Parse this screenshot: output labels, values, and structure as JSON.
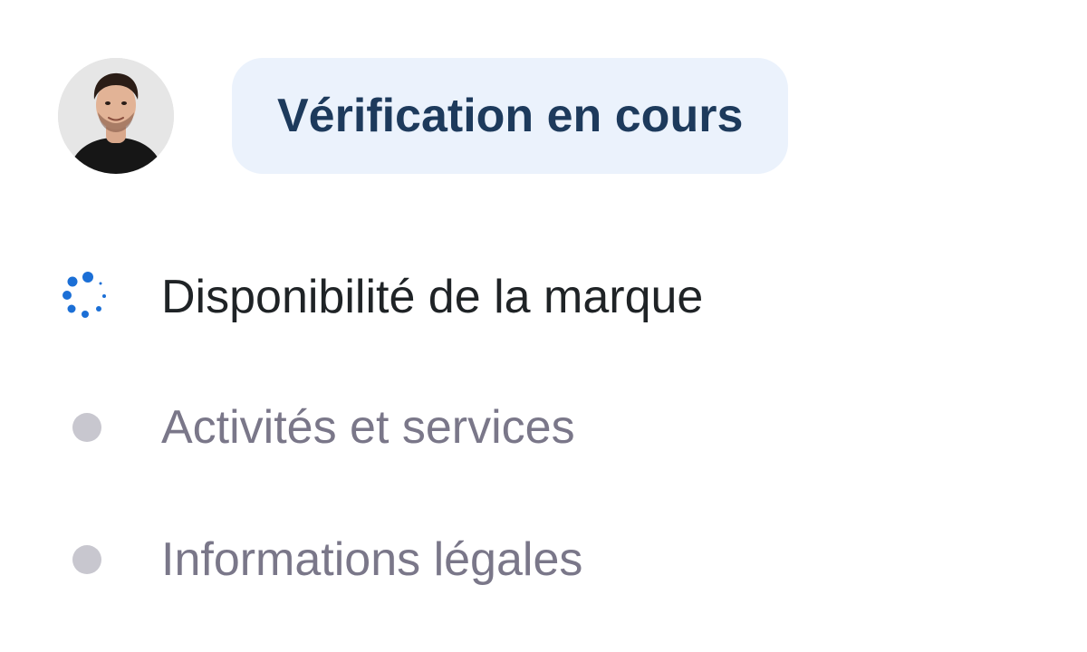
{
  "status": {
    "label": "Vérification en cours"
  },
  "steps": [
    {
      "label": "Disponibilité de la marque",
      "state": "in-progress"
    },
    {
      "label": "Activités et services",
      "state": "pending"
    },
    {
      "label": "Informations légales",
      "state": "pending"
    }
  ],
  "colors": {
    "pill_bg": "#ebf2fc",
    "pill_text": "#1d3a5c",
    "spinner": "#1b6fd6",
    "active_text": "#1f2326",
    "pending_text": "#7a7789",
    "pending_dot": "#c8c7cf"
  },
  "icons": {
    "loading": "spinner-icon",
    "pending": "pending-dot-icon"
  }
}
